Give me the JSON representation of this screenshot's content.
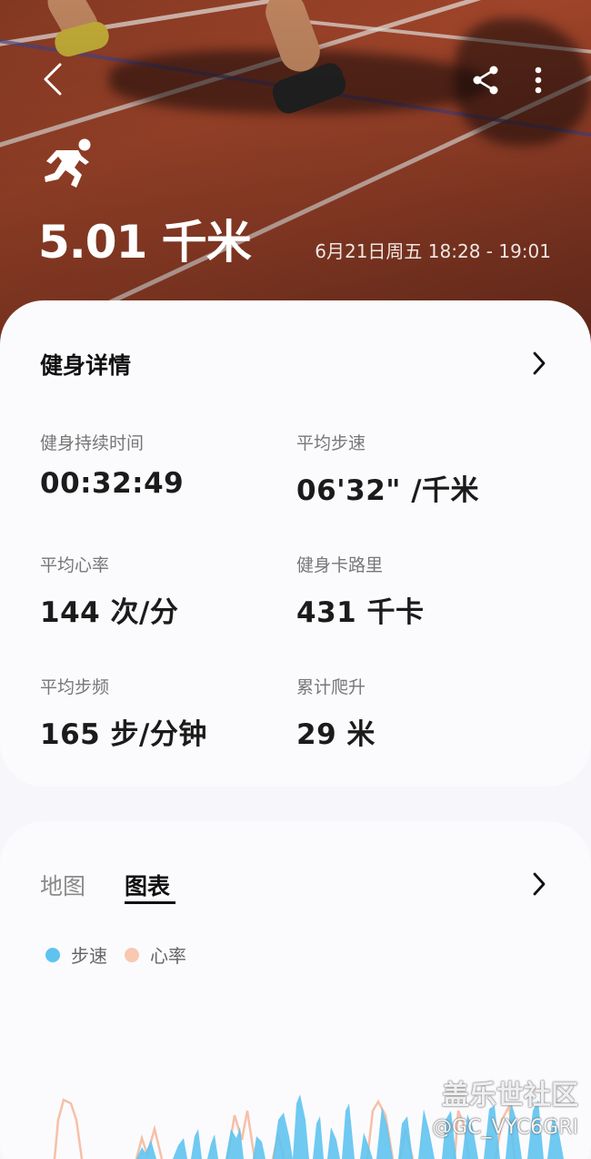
{
  "header": {
    "distance": "5.01 千米",
    "date_range": "6月21日周五 18:28 - 19:01"
  },
  "details": {
    "title": "健身详情",
    "stats": [
      {
        "label": "健身持续时间",
        "value": "00:32:49"
      },
      {
        "label": "平均步速",
        "value": "06'32\" /千米"
      },
      {
        "label": "平均心率",
        "value": "144 次/分"
      },
      {
        "label": "健身卡路里",
        "value": "431 千卡"
      },
      {
        "label": "平均步频",
        "value": "165 步/分钟"
      },
      {
        "label": "累计爬升",
        "value": "29 米"
      }
    ]
  },
  "charts": {
    "tabs": [
      "地图",
      "图表"
    ],
    "active_tab": "图表",
    "legend": [
      {
        "label": "步速",
        "color": "#5fc3ef"
      },
      {
        "label": "心率",
        "color": "#f8c8b0"
      }
    ]
  },
  "watermark": {
    "line1": "盖乐世社区",
    "line2": "@GC_VYC6GRI"
  },
  "colors": {
    "pace": "#5fc3ef",
    "heart_rate": "#f6c0a6",
    "card_bg": "#fbfbfe"
  }
}
